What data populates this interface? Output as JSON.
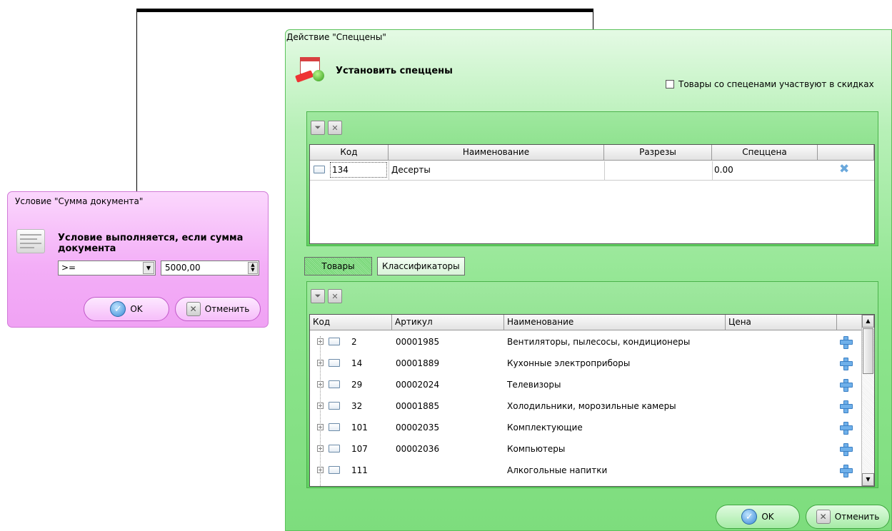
{
  "condition_panel": {
    "title": "Условие \"Сумма документа\"",
    "heading": "Условие выполняется, если сумма документа",
    "operator": ">=",
    "amount": "5000,00",
    "ok_label": "OK",
    "cancel_label": "Отменить"
  },
  "action_panel": {
    "title": "Действие \"Спеццены\"",
    "heading": "Установить спеццены",
    "checkbox_label": "Товары со спеценами участвуют в скидках",
    "top_grid": {
      "columns": [
        "Код",
        "Наименование",
        "Разрезы",
        "Спеццена"
      ],
      "rows": [
        {
          "code": "134",
          "name": "Десерты",
          "sections": "",
          "price": "0.00"
        }
      ]
    },
    "tabs": [
      "Товары",
      "Классификаторы"
    ],
    "bottom_grid": {
      "columns": [
        "Код",
        "Артикул",
        "Наименование",
        "Цена"
      ],
      "rows": [
        {
          "code": "2",
          "article": "00001985",
          "name": "Вентиляторы, пылесосы, кондиционеры",
          "price": ""
        },
        {
          "code": "14",
          "article": "00001889",
          "name": "Кухонные электроприборы",
          "price": ""
        },
        {
          "code": "29",
          "article": "00002024",
          "name": "Телевизоры",
          "price": ""
        },
        {
          "code": "32",
          "article": "00001885",
          "name": "Холодильники, морозильные камеры",
          "price": ""
        },
        {
          "code": "101",
          "article": "00002035",
          "name": "Комплектующие",
          "price": ""
        },
        {
          "code": "107",
          "article": "00002036",
          "name": "Компьютеры",
          "price": ""
        },
        {
          "code": "111",
          "article": "",
          "name": "Алкогольные напитки",
          "price": ""
        }
      ]
    },
    "ok_label": "OK",
    "cancel_label": "Отменить"
  }
}
